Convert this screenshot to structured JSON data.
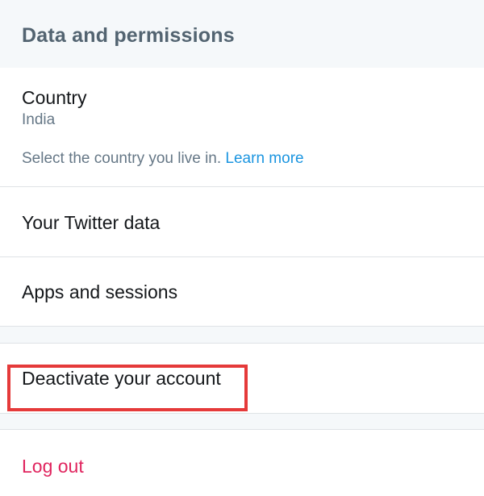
{
  "section": {
    "title": "Data and permissions"
  },
  "country": {
    "label": "Country",
    "value": "India",
    "hint_text": "Select the country you live in.",
    "hint_link": "Learn more"
  },
  "items": {
    "twitter_data": "Your Twitter data",
    "apps_sessions": "Apps and sessions",
    "deactivate": "Deactivate your account",
    "logout": "Log out"
  },
  "colors": {
    "header_text": "#536471",
    "link": "#1b95e0",
    "logout": "#e0245e",
    "highlight": "#e53a3a"
  }
}
